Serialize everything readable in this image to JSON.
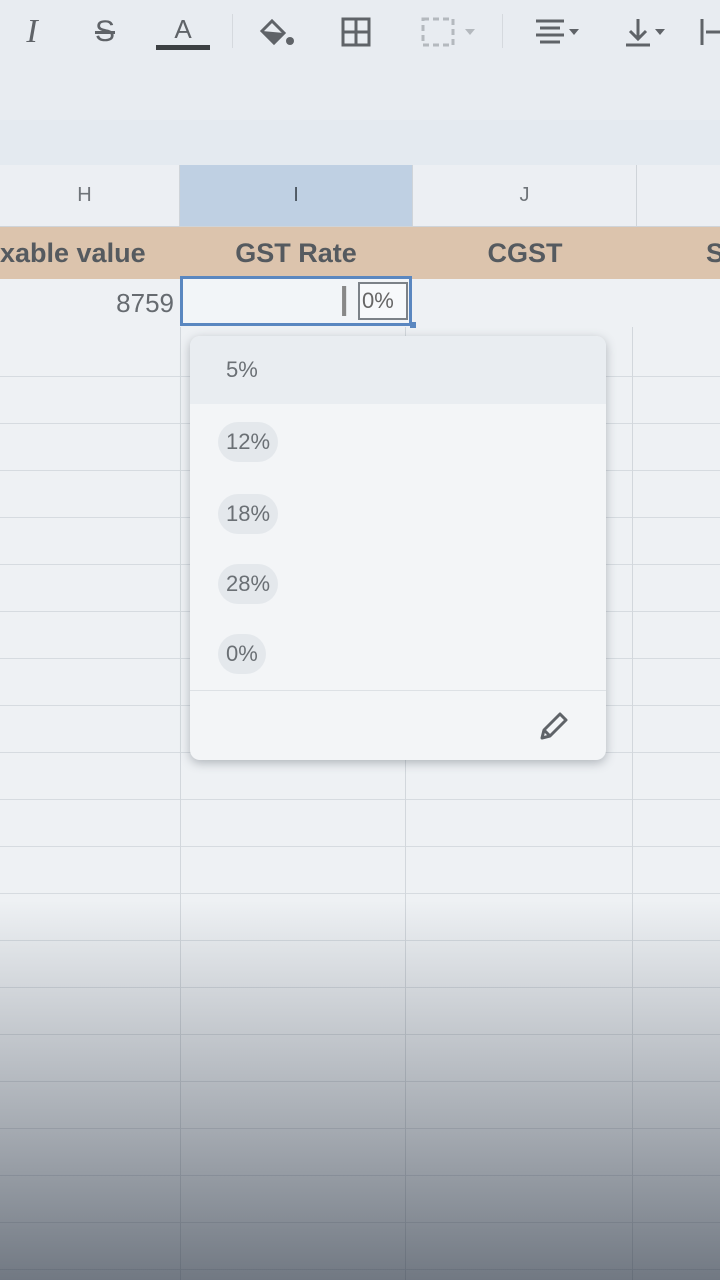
{
  "toolbar": {
    "italic_label": "I",
    "strike_label": "S",
    "text_color_label": "A",
    "items": [
      "italic-icon",
      "strikethrough-icon",
      "text-color-icon",
      "fill-color-icon",
      "borders-icon",
      "merge-cells-icon",
      "horizontal-align-icon",
      "vertical-align-icon",
      "text-wrap-icon"
    ],
    "text_color_bar": "#3c4043"
  },
  "columns": {
    "h": "H",
    "i": "I",
    "j": "J"
  },
  "header_row": {
    "taxable_value": "xable value",
    "gst_rate": "GST Rate",
    "cgst": "CGST",
    "next": "S",
    "background": "#dcc4ad"
  },
  "row2": {
    "taxable_value": "8759",
    "gst_rate_editing": "0%"
  },
  "dropdown": {
    "options": [
      "5%",
      "12%",
      "18%",
      "28%",
      "0%"
    ],
    "edit_icon": "pencil-icon"
  }
}
